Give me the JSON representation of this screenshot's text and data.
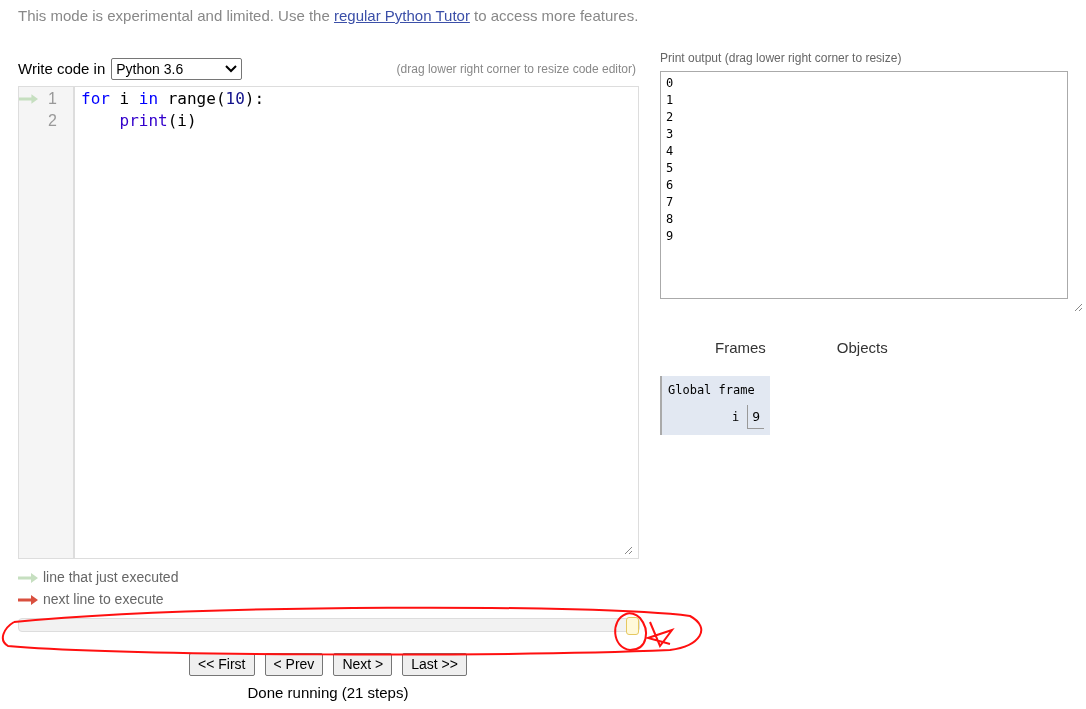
{
  "notice": {
    "text_before": "This mode is experimental and limited. Use the ",
    "link": "regular Python Tutor",
    "text_after": " to access more features."
  },
  "editor": {
    "label": "Write code in",
    "language": "Python 3.6",
    "hint": "(drag lower right corner to resize code editor)",
    "lines": [
      {
        "number": "1",
        "just_executed": true,
        "tokens": [
          {
            "kind": "keyword",
            "text": "for"
          },
          {
            "kind": "plain",
            "text": " i "
          },
          {
            "kind": "keyword",
            "text": "in"
          },
          {
            "kind": "plain",
            "text": " range("
          },
          {
            "kind": "number",
            "text": "10"
          },
          {
            "kind": "plain",
            "text": "):"
          }
        ]
      },
      {
        "number": "2",
        "just_executed": false,
        "tokens": [
          {
            "kind": "builtin",
            "text": "    print"
          },
          {
            "kind": "plain",
            "text": "(i)"
          }
        ]
      }
    ]
  },
  "legend": [
    {
      "kind": "just_executed",
      "text": "line that just executed"
    },
    {
      "kind": "next",
      "text": "next line to execute"
    }
  ],
  "step_slider": {
    "level": 1.0
  },
  "buttons": [
    "<< First",
    "< Prev",
    "Next >",
    "Last >>"
  ],
  "status": "Done running (21 steps)",
  "output": {
    "label": "Print output (drag lower right corner to resize)",
    "lines": [
      "0",
      "1",
      "2",
      "3",
      "4",
      "5",
      "6",
      "7",
      "8",
      "9"
    ]
  },
  "visualizer": {
    "frames_heading": "Frames",
    "objects_heading": "Objects",
    "frame": {
      "title": "Global frame",
      "variables": [
        {
          "name": "i",
          "value": "9"
        }
      ]
    }
  }
}
